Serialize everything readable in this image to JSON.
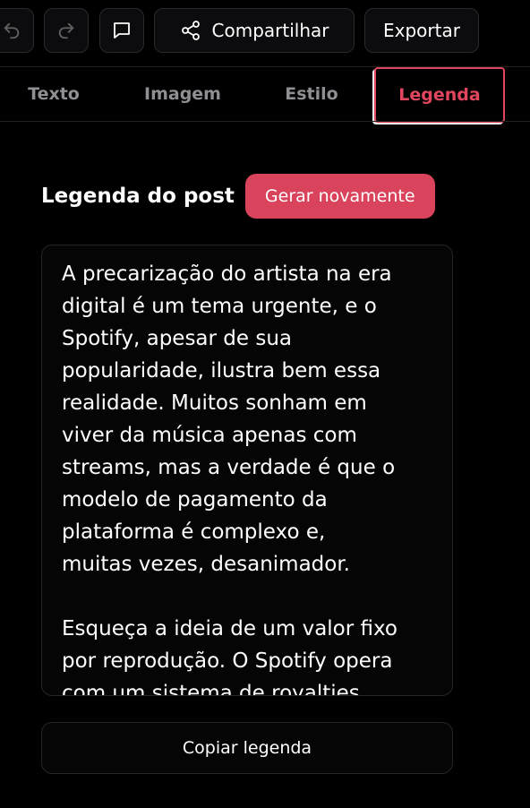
{
  "toolbar": {
    "undo_icon": "undo-icon",
    "redo_icon": "redo-icon",
    "comment_icon": "comment-icon",
    "share_icon": "share-icon",
    "share_label": "Compartilhar",
    "export_label": "Exportar"
  },
  "tabs": [
    {
      "label": "Texto",
      "active": false
    },
    {
      "label": "Imagem",
      "active": false
    },
    {
      "label": "Estilo",
      "active": false
    },
    {
      "label": "Legenda",
      "active": true
    }
  ],
  "caption": {
    "title": "Legenda do post",
    "regenerate_label": "Gerar novamente",
    "text": "A precarização do artista na era\ndigital é um tema urgente, e o\nSpotify, apesar de sua\npopularidade, ilustra bem essa\nrealidade. Muitos sonham em\nviver da música apenas com\nstreams, mas a verdade é que o\nmodelo de pagamento da\nplataforma é complexo e,\nmuitas vezes, desanimador.\n\nEsqueça a ideia de um valor fixo\npor reprodução. O Spotify opera\ncom um sistema de royalties",
    "copy_label": "Copiar legenda"
  },
  "colors": {
    "accent": "#d9435c",
    "background": "#000000",
    "tab_inactive": "#8e8e93"
  }
}
